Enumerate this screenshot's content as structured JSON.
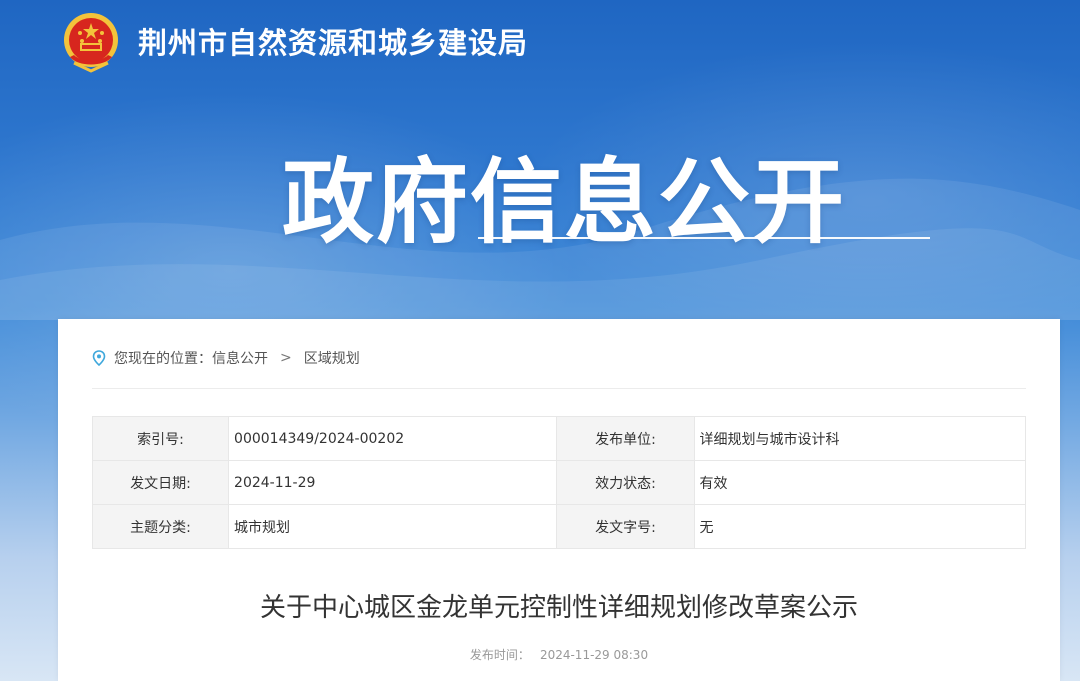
{
  "header": {
    "site_title": "荆州市自然资源和城乡建设局",
    "banner_title": "政府信息公开"
  },
  "breadcrumb": {
    "prefix": "您现在的位置：",
    "items": [
      "信息公开",
      "区域规划"
    ],
    "separator": ">"
  },
  "meta": {
    "rows": [
      {
        "k1": "索引号:",
        "v1": "000014349/2024-00202",
        "k2": "发布单位:",
        "v2": "详细规划与城市设计科"
      },
      {
        "k1": "发文日期:",
        "v1": "2024-11-29",
        "k2": "效力状态:",
        "v2": "有效"
      },
      {
        "k1": "主题分类:",
        "v1": "城市规划",
        "k2": "发文字号:",
        "v2": "无"
      }
    ]
  },
  "article": {
    "title": "关于中心城区金龙单元控制性详细规划修改草案公示",
    "publish_label": "发布时间：",
    "publish_time": "2024-11-29 08:30"
  },
  "colors": {
    "header_blue": "#1f66c2",
    "emblem_red": "#d7261e",
    "emblem_gold": "#f3c33b"
  }
}
